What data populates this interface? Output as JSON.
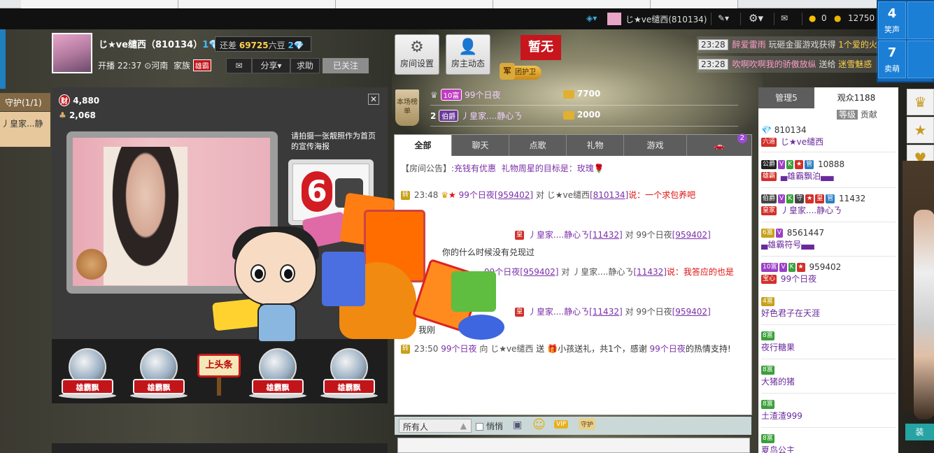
{
  "browser_tabs": [
    "",
    "",
    "",
    "",
    ""
  ],
  "topbar": {
    "user": "じ★ve缱西(810134)",
    "coins": "0",
    "gold": "12750"
  },
  "tiles": [
    {
      "num": "4",
      "label": "笑声"
    },
    {
      "num": "7",
      "label": "卖萌"
    }
  ],
  "host": {
    "name": "じ★ve缱西（810134）",
    "gap_label": "还差",
    "gap_value": "69725",
    "gap_unit": "六豆",
    "gap_level": "2",
    "start": "开播 22:37",
    "loc": "河南",
    "family": "家族",
    "family_badge": "雄霸",
    "btn_share": "分享",
    "btn_beg": "求助",
    "btn_follow": "已关注"
  },
  "room_buttons": {
    "settings": "房间设置",
    "dynamics": "房主动态"
  },
  "zanwu": "暂无",
  "jun": {
    "badge": "军",
    "label": "团护卫"
  },
  "ticker": [
    {
      "time": "23:28",
      "user": "醉爱雷雨",
      "text": "玩砸金蛋游戏获得",
      "tail": "1个爱的火"
    },
    {
      "time": "23:28",
      "user": "吹啊吹啊我的骄傲放纵",
      "text": "送给",
      "tail": "迷雪魅惑"
    }
  ],
  "guard": {
    "title": "守护(1/1)",
    "item": "丿皇家...静"
  },
  "stats": {
    "wealth": "4,880",
    "fans": "2,068",
    "wealth_icon": "财"
  },
  "poster_prompt": "请拍摄一张靓照作为首页的宣传海报",
  "fans": [
    {
      "name": "雄霸飘"
    },
    {
      "name": "雄霸飘"
    },
    {
      "name": "雄霸飘"
    },
    {
      "name": "雄霸飘"
    }
  ],
  "shangtoutiao": "上头条",
  "rank": {
    "tag": "本场榜单",
    "rows": [
      {
        "pos": "",
        "lvl": "10富",
        "name": "99个日夜",
        "score": "7700"
      },
      {
        "pos": "2",
        "lvl": "伯爵",
        "name": "丿皇家....静心ㄋ",
        "score": "2000"
      }
    ]
  },
  "chat_tabs": {
    "all": "全部",
    "chat": "聊天",
    "song": "点歌",
    "gift": "礼物",
    "game": "游戏",
    "car_count": "2"
  },
  "chat": {
    "notice_label": "【房间公告】:",
    "notice_a": "充钱有优惠",
    "notice_b": "礼物周星的目标是：玫瑰",
    "l1_time": "23:48",
    "l1_from": "99个日夜",
    "l1_from_id": "[959402]",
    "l1_to": "对 じ★ve缱西",
    "l1_to_id": "[810134]",
    "l1_msg": "说：一个求包养吧",
    "l2_from": "丿皇家....静心ㄋ",
    "l2_from_id": "[11432]",
    "l2_to": "对 99个日夜",
    "l2_to_id": "[959402]",
    "l2_msg": "你的什么时候没有兑现过",
    "l3_from": "99个日夜",
    "l3_from_id": "[959402]",
    "l3_to": "对 丿皇家....静心ㄋ",
    "l3_to_id": "[11432]",
    "l3_msg": "说：我答应的也是",
    "l4_from": "丿皇家....静心ㄋ",
    "l4_from_id": "[11432]",
    "l4_to": "对 99个日夜",
    "l4_to_id": "[959402]",
    "l5_pre": "我刚",
    "l6_time": "23:50",
    "l6_from": "99个日夜",
    "l6_mid": "向 じ★ve缱西",
    "l6_act": "送",
    "l6_gift": "小孩送礼，共1个，感谢",
    "l6_user": "99个日夜",
    "l6_end": "的热情支持!"
  },
  "input": {
    "target": "所有人",
    "whisper": "悄悄",
    "vip": "VIP",
    "guard": "守护"
  },
  "right": {
    "tab_admin": "管理5",
    "tab_audience": "观众1188",
    "sub_level": "等级",
    "sub_contrib": "贡献",
    "users": [
      {
        "badges": "1",
        "id": "810134",
        "role": "六道",
        "name": "じ★ve缱西"
      },
      {
        "badges": "公爵",
        "id": "10888",
        "role": "雄霸",
        "name": "▄雄霸飘泊▄▄"
      },
      {
        "badges": "伯爵",
        "id": "11432",
        "role": "皇家",
        "name": "丿皇家....静心ㄋ"
      },
      {
        "badges": "6富",
        "id": "8561447",
        "role": "",
        "name": "▄雄霸符号▄▄"
      },
      {
        "badges": "10富",
        "id": "959402",
        "role": "宝心",
        "name": "99个日夜"
      },
      {
        "badges": "4富",
        "id": "",
        "role": "",
        "name": "好色君子在天涯"
      },
      {
        "badges": "8富",
        "id": "",
        "role": "",
        "name": "夜行糖果"
      },
      {
        "badges": "8富",
        "id": "",
        "role": "",
        "name": "大猪的猪"
      },
      {
        "badges": "8富",
        "id": "",
        "role": "",
        "name": "土渣渣999"
      },
      {
        "badges": "8富",
        "id": "",
        "role": "",
        "name": "夏鸟公主"
      }
    ]
  },
  "side_label": "装"
}
